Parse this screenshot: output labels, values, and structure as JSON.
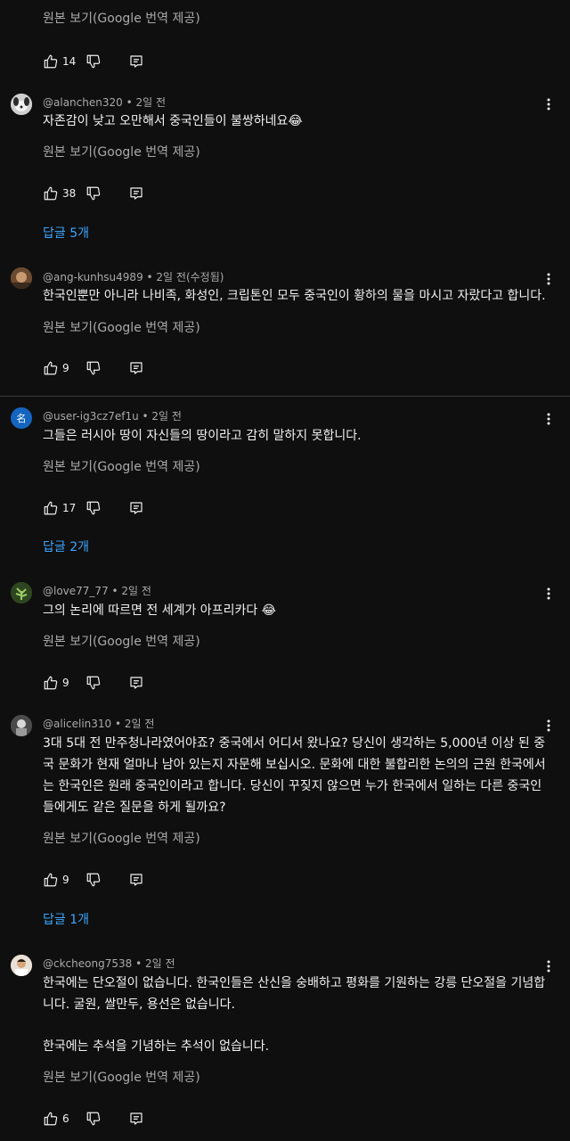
{
  "translate_label": "원본 보기(Google 번역 제공)",
  "top": {
    "likes": "14"
  },
  "comments": [
    {
      "user": "@alanchen320",
      "time": "2일 전",
      "text": "자존감이 낮고 오만해서 중국인들이 불쌍하네요😂",
      "likes": "38",
      "replies": "답글 5개"
    },
    {
      "user": "@ang-kunhsu4989",
      "time": "2일 전(수정됨)",
      "text": "한국인뿐만 아니라 나비족, 화성인, 크립톤인 모두 중국인이 황하의 물을 마시고 자랐다고 합니다.",
      "likes": "9"
    },
    {
      "user": "@user-ig3cz7ef1u",
      "time": "2일 전",
      "text": "그들은 러시아 땅이 자신들의 땅이라고 감히 말하지 못합니다.",
      "likes": "17",
      "replies": "답글 2개",
      "avatar_letter": "名"
    },
    {
      "user": "@love77_77",
      "time": "2일 전",
      "text": "그의 논리에 따르면 전 세계가 아프리카다 😂",
      "likes": "9"
    },
    {
      "user": "@alicelin310",
      "time": "2일 전",
      "text": "3대 5대 전 만주청나라였어야죠? 중국에서 어디서 왔나요? 당신이 생각하는 5,000년 이상 된 중국 문화가 현재 얼마나 남아 있는지 자문해 보십시오. 문화에 대한 불합리한 논의의 근원 한국에서는 한국인은 원래 중국인이라고 합니다. 당신이 꾸짖지 않으면 누가 한국에서 일하는 다른 중국인들에게도 같은 질문을 하게 될까요?",
      "likes": "9",
      "replies": "답글 1개"
    },
    {
      "user": "@ckcheong7538",
      "time": "2일 전",
      "text": "한국에는 단오절이 없습니다. 한국인들은 산신을 숭배하고 평화를 기원하는 강릉 단오절을 기념합니다. 굴원, 쌀만두, 용선은 없습니다.",
      "text2": "한국에는 추석을 기념하는 추석이 없습니다.",
      "likes": "6"
    }
  ],
  "colors": {
    "background": "#0f0f0f",
    "text": "#f1f1f1",
    "secondary": "#aaaaaa",
    "link": "#3ea6ff"
  }
}
